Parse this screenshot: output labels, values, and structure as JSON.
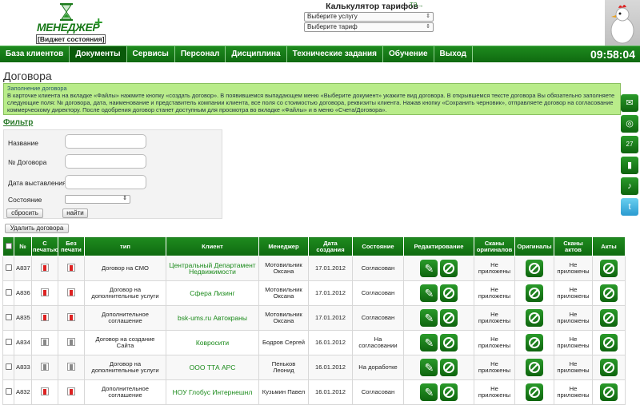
{
  "header": {
    "brand": "МЕНЕДЖЕР",
    "plus": "+",
    "subtitle": "[Виджет состояния]",
    "calc_title": "Калькулятор тарифов",
    "tz_link": "ТЗ→",
    "service_select": "Выберите услугу",
    "tariff_select": "Выберите тариф"
  },
  "nav": {
    "items": [
      "База клиентов",
      "Документы",
      "Сервисы",
      "Персонал",
      "Дисциплина",
      "Технические задания",
      "Обучение",
      "Выход"
    ],
    "active": 1,
    "clock": "09:58:04"
  },
  "page": {
    "title": "Договора",
    "hint_head": "Заполнение договора",
    "hint_text": "В карточке клиента на вкладке «Файлы» нажмите кнопку «создать договор». В появившемся выпадающем меню «Выберите документ» укажите вид договора. В открывшемся тексте договора Вы обязательно заполняете следующие поля: № договора, дата, наименование и представитель компании клиента, все поля со стоимостью договора, реквизиты клиента. Нажав кнопку «Сохранить черновик», отправляете договор на согласование коммерческому директору. После одобрения договор станет доступным для просмотра во вкладке «Файлы» и в меню «Счета/Договора»."
  },
  "filter": {
    "link": "Фильтр",
    "name_label": "Название",
    "number_label": "№ Договора",
    "date_label": "Дата выставления",
    "status_label": "Состояние",
    "reset": "сбросить",
    "find": "найти"
  },
  "delete_button": "Удалить договора",
  "table": {
    "headers": [
      "№",
      "С печатью",
      "Без печати",
      "тип",
      "Клиент",
      "Менеджер",
      "Дата создания",
      "Состояние",
      "Редактирование",
      "Сканы оригиналов",
      "Оригиналы",
      "Сканы актов",
      "Акты"
    ],
    "rows": [
      {
        "num": "A837",
        "type": "Договор на СМО",
        "client": "Центральный Департамент Недвижимости",
        "manager": "Мотовильник Оксана",
        "date": "17.01.2012",
        "status": "Согласован",
        "scans": "Не приложены",
        "act_scans": "Не приложены",
        "print": "red",
        "noprint": "red"
      },
      {
        "num": "A836",
        "type": "Договор на дополнительные услуги",
        "client": "Сфера Лизинг",
        "manager": "Мотовильник Оксана",
        "date": "17.01.2012",
        "status": "Согласован",
        "scans": "Не приложены",
        "act_scans": "Не приложены",
        "print": "red",
        "noprint": "red"
      },
      {
        "num": "A835",
        "type": "Дополнительное соглашение",
        "client": "bsk-ums.ru Автокраны",
        "manager": "Мотовильник Оксана",
        "date": "17.01.2012",
        "status": "Согласован",
        "scans": "Не приложены",
        "act_scans": "Не приложены",
        "print": "red",
        "noprint": "red"
      },
      {
        "num": "A834",
        "type": "Договор на создание Сайта",
        "client": "Ковросити",
        "manager": "Бодров Сергей",
        "date": "16.01.2012",
        "status": "На согласовании",
        "scans": "Не приложены",
        "act_scans": "Не приложены",
        "print": "grey",
        "noprint": "grey"
      },
      {
        "num": "A833",
        "type": "Договор на дополнительные услуги",
        "client": "ООО ТТА АРС",
        "manager": "Пеньков Леонид",
        "date": "16.01.2012",
        "status": "На доработке",
        "scans": "Не приложены",
        "act_scans": "Не приложены",
        "print": "grey",
        "noprint": "grey"
      },
      {
        "num": "A832",
        "type": "Дополнительное соглашение",
        "client": "НОУ Глобус Интернешнл",
        "manager": "Кузьмин Павел",
        "date": "16.01.2012",
        "status": "Согласован",
        "scans": "Не приложены",
        "act_scans": "Не приложены",
        "print": "red",
        "noprint": "red"
      }
    ]
  },
  "colors": {
    "primary_green": "#0f6a10",
    "hint_bg": "#b9ec8a",
    "client_link": "#1a8a1a"
  },
  "side_icons": [
    "mail-icon",
    "lifebuoy-icon",
    "calendar-icon",
    "book-icon",
    "bell-icon",
    "twitter-icon"
  ],
  "calendar_day": "27"
}
